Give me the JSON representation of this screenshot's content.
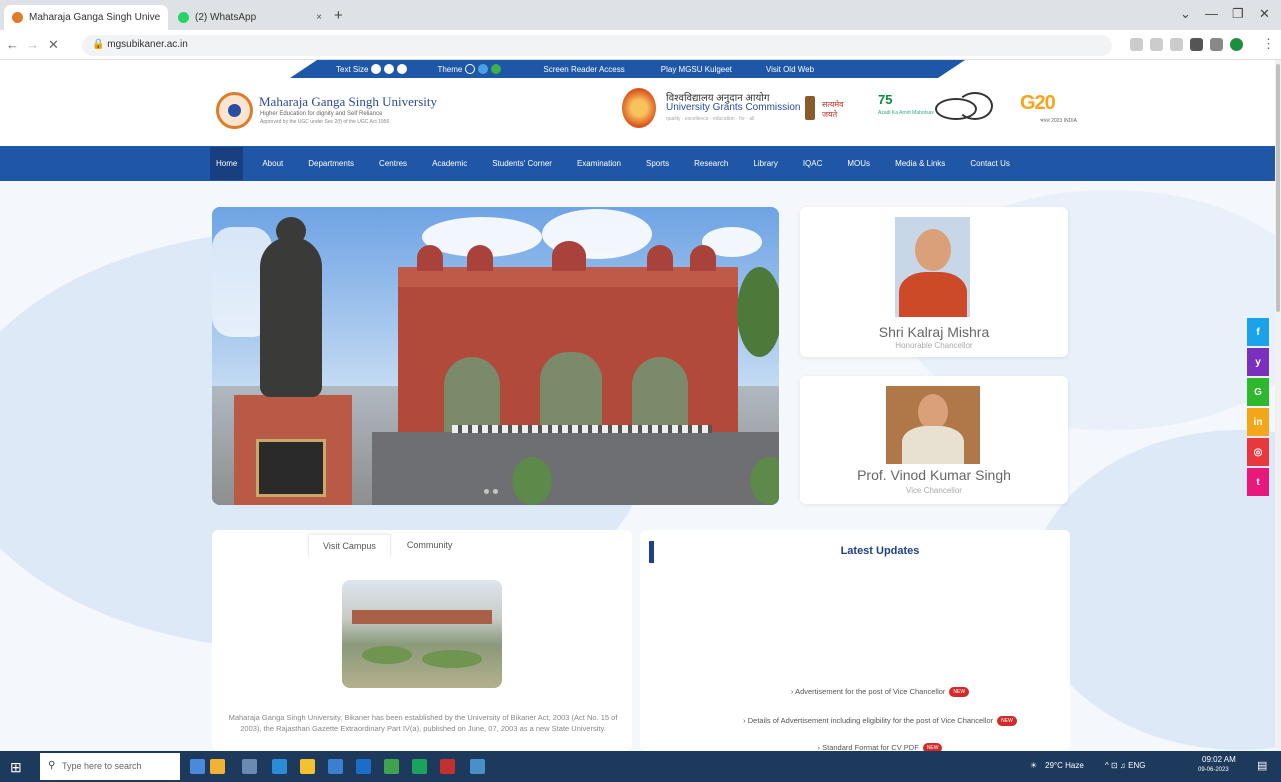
{
  "browser": {
    "tabs": [
      {
        "title": "Maharaja Ganga Singh University ×",
        "active": true
      },
      {
        "title": "(2) WhatsApp",
        "active": false
      }
    ],
    "tab_close": "×",
    "new_tab": "+",
    "url": "mgsubikaner.ac.in",
    "window_controls": [
      "⌄",
      "—",
      "❐",
      "✕"
    ],
    "nav_buttons": [
      "←",
      "→",
      "✕"
    ]
  },
  "topbar": {
    "text_size": "Text Size",
    "theme": "Theme",
    "screen_reader": "Screen Reader Access",
    "play_kulgeet": "Play MGSU Kulgeet",
    "old_web": "Visit Old Web",
    "text_size_colors": [
      "#ffffff",
      "#ffffff",
      "#ffffff"
    ],
    "theme_colors": [
      "#1e57a8",
      "#4aa0e0",
      "#3bb04a"
    ]
  },
  "header": {
    "university_name": "Maharaja Ganga Singh University",
    "tagline": "Higher Education for dignity and Self Reliance",
    "sub_tagline": "Approved by the UGC under Sec 2(f) of the UGC Act 1956",
    "ugc_hindi": "विश्वविद्यालय अनुदान आयोग",
    "ugc_english": "University Grants Commission",
    "ugc_sub": "quality · excellence · education · for · all",
    "gov_text_line1": "सत्यमेव",
    "gov_text_line2": "जयते",
    "azadi": "75",
    "azadi_sub": "Azadi Ka Amrit Mahotsav",
    "g20": "G20",
    "g20_sub": "भारत 2023 INDIA"
  },
  "nav": {
    "items": [
      "Home",
      "About",
      "Departments",
      "Centres",
      "Academic",
      "Students' Corner",
      "Examination",
      "Sports",
      "Research",
      "Library",
      "IQAC",
      "MOUs",
      "Media & Links",
      "Contact Us"
    ],
    "active": "Home"
  },
  "people": [
    {
      "name": "Shri Kalraj Mishra",
      "role": "Honorable Chancellor"
    },
    {
      "name": "Prof. Vinod Kumar Singh",
      "role": "Vice Chancellor"
    }
  ],
  "campus_tabs": [
    "Visit Campus",
    "Community"
  ],
  "campus_text": "Maharaja Ganga Singh University, Bikaner has been established by the University of Bikaner Act, 2003 (Act No. 15 of 2003), the Rajasthan Gazette Extraordinary Part IV(a), published on June, 07, 2003 as a new State University.",
  "updates": {
    "title": "Latest Updates",
    "new_badge": "NEW",
    "items": [
      "Advertisement for the post of Vice Chancellor",
      "Details of Advertisement including eligibility for the post of Vice Chancellor",
      "Standard Format for CV PDF"
    ]
  },
  "social": [
    {
      "icon": "facebook-icon",
      "glyph": "f",
      "color": "#1aa3e8"
    },
    {
      "icon": "twitter-icon",
      "glyph": "y",
      "color": "#7b2fbf"
    },
    {
      "icon": "google-icon",
      "glyph": "G",
      "color": "#2eb82e"
    },
    {
      "icon": "linkedin-icon",
      "glyph": "in",
      "color": "#f2a71b"
    },
    {
      "icon": "instagram-icon",
      "glyph": "◎",
      "color": "#e8383d"
    },
    {
      "icon": "tumblr-icon",
      "glyph": "t",
      "color": "#e8197a"
    }
  ],
  "taskbar": {
    "search_placeholder": "Type here to search",
    "weather": "29°C Haze",
    "tray": "^ ⊡ ♫ ENG",
    "time": "09:02 AM",
    "date": "09-06-2023"
  }
}
